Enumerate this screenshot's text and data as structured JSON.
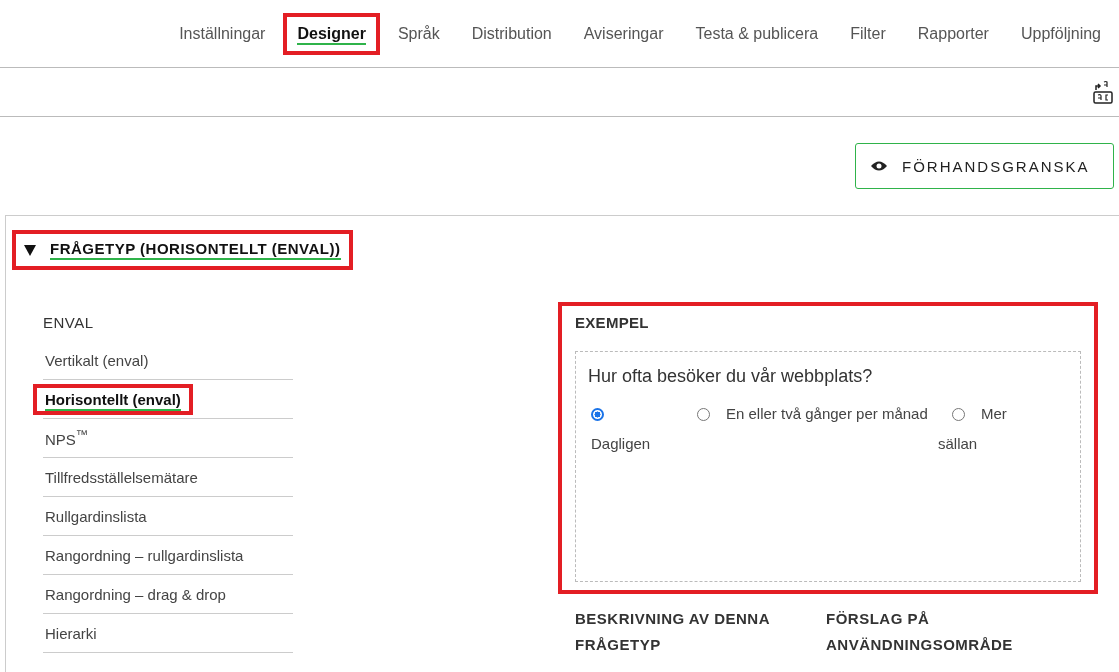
{
  "tabs": [
    {
      "label": "Inställningar",
      "selected": false,
      "highlighted": false
    },
    {
      "label": "Designer",
      "selected": true,
      "highlighted": true
    },
    {
      "label": "Språk",
      "selected": false,
      "highlighted": false
    },
    {
      "label": "Distribution",
      "selected": false,
      "highlighted": false
    },
    {
      "label": "Aviseringar",
      "selected": false,
      "highlighted": false
    },
    {
      "label": "Testa & publicera",
      "selected": false,
      "highlighted": false
    },
    {
      "label": "Filter",
      "selected": false,
      "highlighted": false
    },
    {
      "label": "Rapporter",
      "selected": false,
      "highlighted": false
    },
    {
      "label": "Uppföljning",
      "selected": false,
      "highlighted": false
    }
  ],
  "preview_button": {
    "label": "FÖRHANDSGRANSKA"
  },
  "section": {
    "title": "FRÅGETYP (HORISONTELLT (ENVAL))",
    "expanded": true,
    "highlighted": true
  },
  "question_types": {
    "heading": "ENVAL",
    "items": [
      {
        "label": "Vertikalt (enval)",
        "selected": false,
        "highlighted": false
      },
      {
        "label": "Horisontellt (enval)",
        "selected": true,
        "highlighted": true
      },
      {
        "label": "NPS$^{™}$",
        "selected": false,
        "highlighted": false
      },
      {
        "label": "Tillfredsställelsemätare",
        "selected": false,
        "highlighted": false
      },
      {
        "label": "Rullgardinslista",
        "selected": false,
        "highlighted": false
      },
      {
        "label": "Rangordning – rullgardinslista",
        "selected": false,
        "highlighted": false
      },
      {
        "label": "Rangordning – drag & drop",
        "selected": false,
        "highlighted": false
      },
      {
        "label": "Hierarki",
        "selected": false,
        "highlighted": false
      }
    ]
  },
  "example": {
    "heading": "EXEMPEL",
    "highlighted": true,
    "question": "Hur ofta besöker du vår webbplats?",
    "options": [
      {
        "label": "Dagligen",
        "selected": true
      },
      {
        "label": "En eller två gånger per månad",
        "selected": false
      },
      {
        "label": "Mer sällan",
        "selected": false
      }
    ]
  },
  "description_heading": "BESKRIVNING AV DENNA FRÅGETYP",
  "usage_heading": "FÖRSLAG PÅ ANVÄNDNINGSOMRÅDE"
}
